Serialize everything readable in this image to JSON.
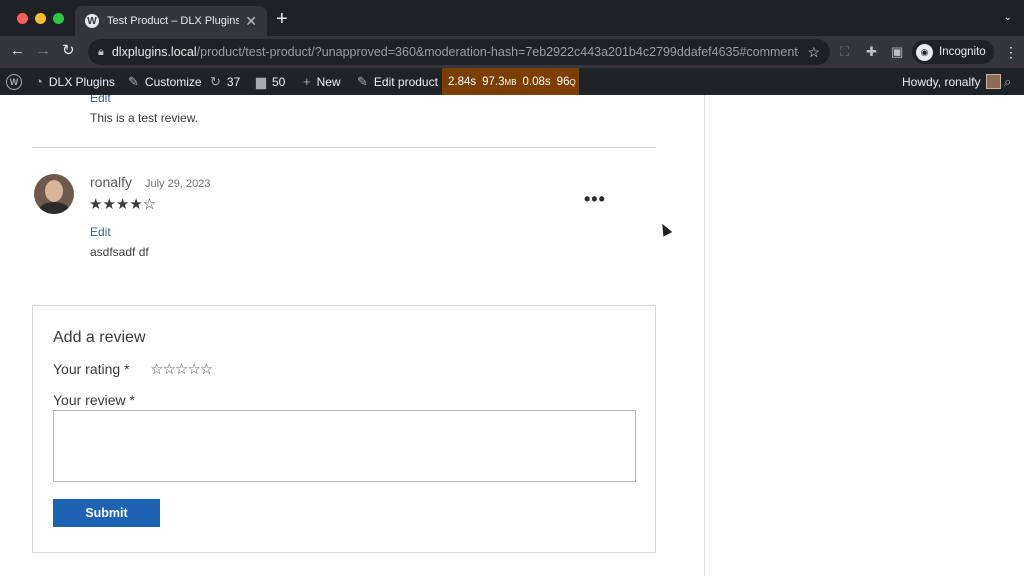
{
  "browser": {
    "tab_title": "Test Product – DLX Plugins",
    "tab_close": "✕",
    "new_tab": "+",
    "tab_menu": "⌄",
    "url_host": "dlxplugins.local",
    "url_path": "/product/test-product/?unapproved=360&moderation-hash=7eb2922c443a201b4c2799ddafef4635#comment-...",
    "profile_label": "Incognito",
    "icons": [
      "back-arrow-icon",
      "forward-arrow-icon",
      "reload-icon",
      "lock-icon",
      "bookmark-star-icon",
      "expand-icon",
      "extensions-puzzle-icon",
      "side-panel-icon",
      "incognito-icon",
      "kebab-menu-icon"
    ]
  },
  "adminbar": {
    "site_name": "DLX Plugins",
    "customize": "Customize",
    "updates_count": "37",
    "comments_count": "50",
    "new_label": "New",
    "edit_product": "Edit product",
    "qm_time": "2.84s",
    "qm_memory": "97.3",
    "qm_memory_unit": "MB",
    "qm_db_time": "0.08s",
    "qm_queries": "96",
    "qm_queries_unit": "Q",
    "howdy": "Howdy, ronalfy"
  },
  "previous_review": {
    "edit_link": "Edit",
    "text": "This is a test review."
  },
  "comment": {
    "author": "ronalfy",
    "date": "July 29, 2023",
    "rating_stars": "★★★★☆",
    "rating": 4,
    "rating_max": 5,
    "more_menu": "•••",
    "edit_link": "Edit",
    "text": "asdfsadf df"
  },
  "review_form": {
    "title": "Add a review",
    "rating_label": "Your rating *",
    "rating_stars": "☆☆☆☆☆",
    "review_label": "Your review *",
    "review_value": "",
    "submit_label": "Submit"
  },
  "colors": {
    "admin_bar_bg": "#1d2327",
    "query_monitor_bg": "#7a3f00",
    "link": "#2e5f93",
    "submit_bg": "#1e62b3"
  }
}
